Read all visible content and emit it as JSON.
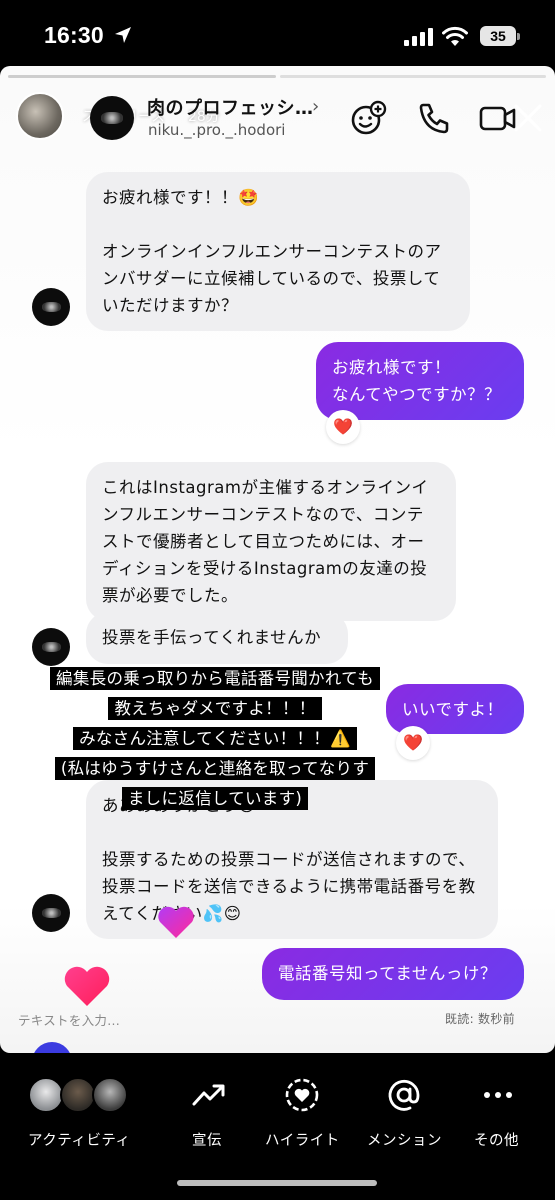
{
  "status_bar": {
    "time": "16:30",
    "battery": "35",
    "icons": [
      "location-arrow-icon",
      "signal-icon",
      "wifi-icon",
      "battery-icon"
    ]
  },
  "story": {
    "owner_label": "ストーリーズ",
    "time_ago": "28分"
  },
  "dm_header": {
    "title": "肉のプロフェッシ…",
    "handle": "niku._.pro._.hodori",
    "icons": [
      "effects-icon",
      "phone-icon",
      "video-icon",
      "close-icon"
    ]
  },
  "messages": [
    {
      "side": "in",
      "text": "お疲れ様です！！🤩\n\nオンラインインフルエンサーコンテストのアンバサダーに立候補しているので、投票していただけますか？"
    },
    {
      "side": "out",
      "text": "お疲れ様です！\nなんてやつですか？？",
      "reaction": "❤️"
    },
    {
      "side": "in",
      "text": "これはInstagramが主催するオンラインインフルエンサーコンテストなので、コンテストで優勝者として目立つためには、オーディションを受けるInstagramの友達の投票が必要でした。"
    },
    {
      "side": "in",
      "text": "投票を手伝ってくれませんか"
    },
    {
      "side": "out",
      "text": "いいですよ！",
      "reaction": "❤️"
    },
    {
      "side": "in",
      "text": "あああありがとう😊\n\n投票するための投票コードが送信されますので、投票コードを送信できるように携帯電話番号を教えてください💦😊"
    },
    {
      "side": "out",
      "text": "電話番号知ってませんっけ？"
    }
  ],
  "caption": "編集長の乗っ取りから電話番号聞かれても教えちゃダメですよ！！！\nみなさん注意してください！！！⚠️\n(私はゆうすけさんと連絡を取ってなりすましに返信しています)",
  "input_placeholder": "テキストを入力...",
  "read_receipt": "既読: 数秒前",
  "bottom_bar": {
    "activity": "アクティビティ",
    "promote": "宣伝",
    "highlight": "ハイライト",
    "mention": "メンション",
    "more": "その他"
  },
  "colors": {
    "outgoing_bubble": "#7a35ea",
    "incoming_bubble": "#efeff1",
    "heart": "#ff2a6d"
  }
}
